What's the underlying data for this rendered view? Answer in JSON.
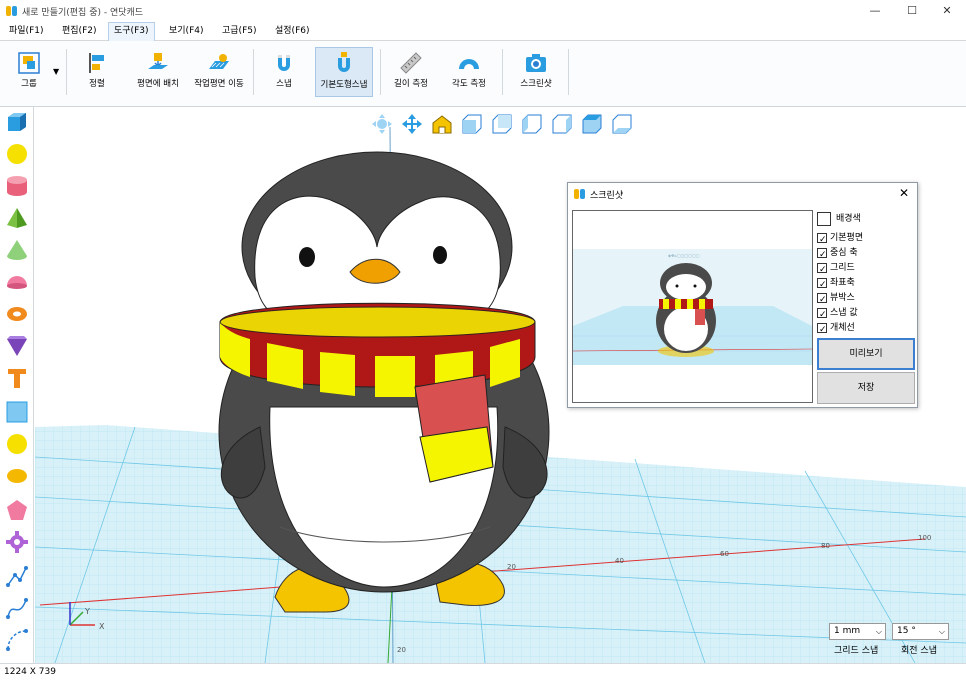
{
  "window": {
    "title": "새로 만들기(편집 중) - 연닷캐드",
    "minimize": "—",
    "maximize": "☐",
    "close": "✕"
  },
  "menu": {
    "items": [
      "파일(F1)",
      "편집(F2)",
      "도구(F3)",
      "보기(F4)",
      "고급(F5)",
      "설정(F6)"
    ],
    "active_index": 2
  },
  "ribbon": {
    "tools": [
      {
        "label": "그룹",
        "icon": "group-icon"
      },
      {
        "label": "정렬",
        "icon": "align-icon"
      },
      {
        "label": "평면에 배치",
        "icon": "place-on-plane-icon"
      },
      {
        "label": "작업평면 이동",
        "icon": "move-workplane-icon"
      },
      {
        "label": "스냅",
        "icon": "magnet-icon"
      },
      {
        "label": "기본도형스냅",
        "icon": "shape-snap-icon",
        "active": true
      },
      {
        "label": "길이 측정",
        "icon": "ruler-icon"
      },
      {
        "label": "각도 측정",
        "icon": "protractor-icon"
      },
      {
        "label": "스크린샷",
        "icon": "camera-icon"
      }
    ]
  },
  "left_toolbar": {
    "shapes": [
      "cube-icon",
      "sphere-icon",
      "cylinder-icon",
      "pyramid-icon",
      "cone-icon",
      "hemisphere-icon",
      "torus-icon",
      "wedge-icon",
      "text-icon",
      "square-icon",
      "circle-icon",
      "ellipse-icon",
      "pentagon-icon",
      "gear-icon",
      "polyline-icon",
      "spline-icon",
      "arc-icon"
    ]
  },
  "viewport": {
    "view_buttons": [
      "orbit-icon",
      "pan-icon",
      "home-view-icon",
      "front-view-icon",
      "back-view-icon",
      "left-view-icon",
      "right-view-icon",
      "top-view-icon",
      "bottom-view-icon"
    ],
    "axis_labels": {
      "x": "X",
      "y": "Y"
    },
    "ruler_labels": [
      "20",
      "40",
      "60",
      "80",
      "100"
    ],
    "depth_label": "20"
  },
  "dialog": {
    "title": "스크린샷",
    "close": "✕",
    "background_label": "배경색",
    "background_checked": false,
    "options": [
      {
        "label": "기본평면",
        "checked": true
      },
      {
        "label": "중심 축",
        "checked": true
      },
      {
        "label": "그리드",
        "checked": true
      },
      {
        "label": "좌표축",
        "checked": true
      },
      {
        "label": "뷰박스",
        "checked": true
      },
      {
        "label": "스냅 값",
        "checked": true
      },
      {
        "label": "개체선",
        "checked": true
      }
    ],
    "preview_button": "미리보기",
    "save_button": "저장"
  },
  "snap": {
    "grid_value": "1 mm",
    "grid_label": "그리드 스냅",
    "rotate_value": "15 °",
    "rotate_label": "회전 스냅"
  },
  "status": {
    "size": "1224 X 739"
  },
  "colors": {
    "accent": "#3c7fd1",
    "grid": "#6fc8e6",
    "scarf_red": "#b01818",
    "scarf_yellow": "#f5f500",
    "beak_orange": "#f0a000"
  }
}
